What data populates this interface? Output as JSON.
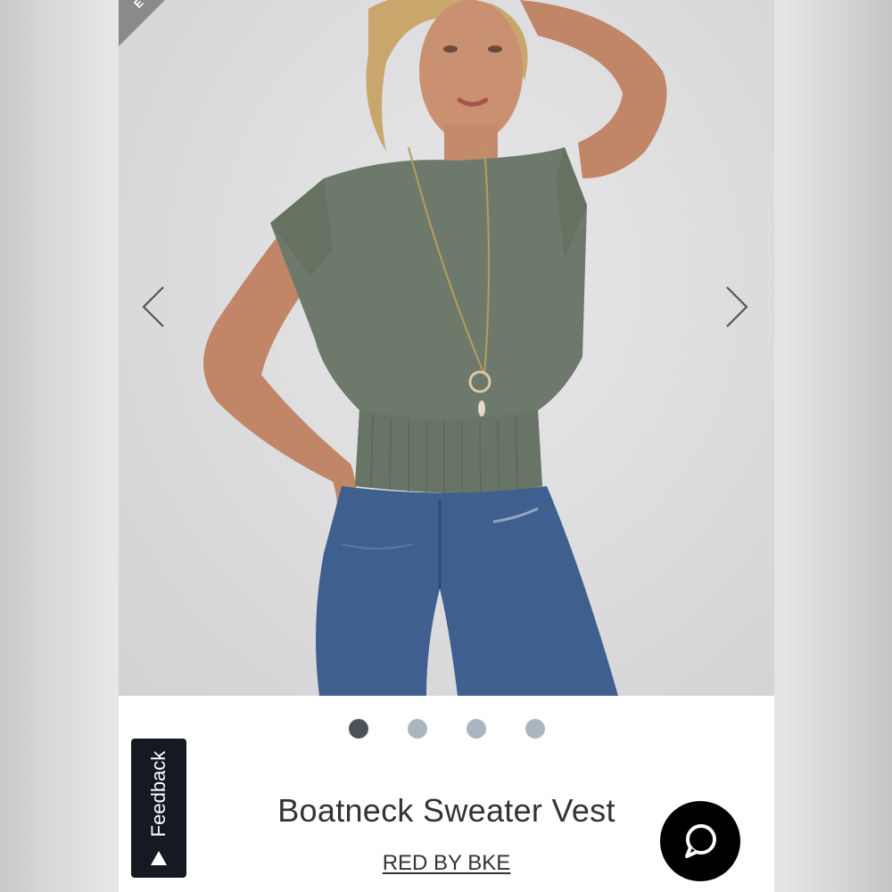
{
  "product": {
    "title": "Boatneck Sweater Vest",
    "brand": "RED BY BKE"
  },
  "gallery": {
    "ribbon_text": "E",
    "image_count": 4,
    "active_index": 0,
    "dots": [
      {
        "state": "active"
      },
      {
        "state": "inactive"
      },
      {
        "state": "inactive"
      },
      {
        "state": "inactive"
      }
    ]
  },
  "feedback": {
    "label": "Feedback"
  },
  "colors": {
    "sweater": "#6d7a6b",
    "denim": "#3f5f8f",
    "dot_active": "#4a525a",
    "dot_inactive": "#a9b6c1",
    "feedback_bg": "#151a22"
  },
  "icons": {
    "prev": "chevron-left-icon",
    "next": "chevron-right-icon",
    "chat": "chat-bubble-icon",
    "feedback_arrow": "triangle-up-icon"
  }
}
